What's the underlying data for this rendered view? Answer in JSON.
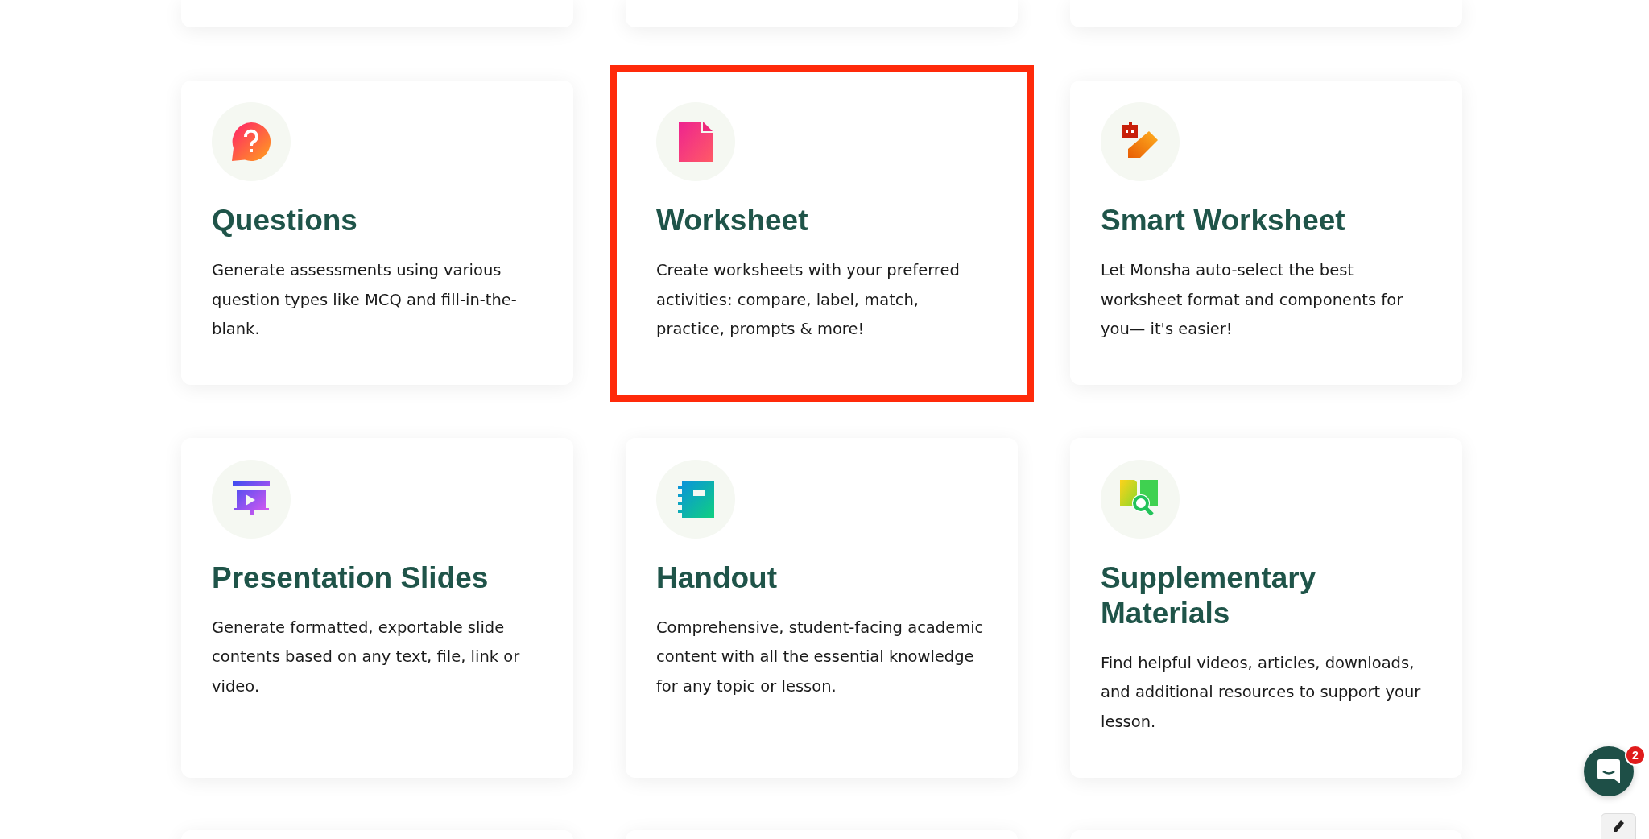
{
  "cards": [
    {
      "kind": "question",
      "title": "Questions",
      "description": "Generate assessments using various question types like MCQ and fill-in-the-blank.",
      "highlighted": false
    },
    {
      "kind": "document",
      "title": "Worksheet",
      "description": "Create worksheets with your preferred activities: compare, label, match, practice, prompts & more!",
      "highlighted": true
    },
    {
      "kind": "robot-pencil",
      "title": "Smart Worksheet",
      "description": "Let Monsha auto-select the best worksheet format and components for you— it's easier!",
      "highlighted": false
    },
    {
      "kind": "presentation",
      "title": "Presentation Slides",
      "description": "Generate formatted, exportable slide contents based on any text, file, link or video.",
      "highlighted": false
    },
    {
      "kind": "notebook",
      "title": "Handout",
      "description": "Comprehensive, student-facing academic content with all the essential knowledge for any topic or lesson.",
      "highlighted": false
    },
    {
      "kind": "search-folder",
      "title": "Supplementary Materials",
      "description": "Find helpful videos, articles, downloads, and additional resources to support your lesson.",
      "highlighted": false
    }
  ],
  "chat": {
    "badge": "2"
  }
}
